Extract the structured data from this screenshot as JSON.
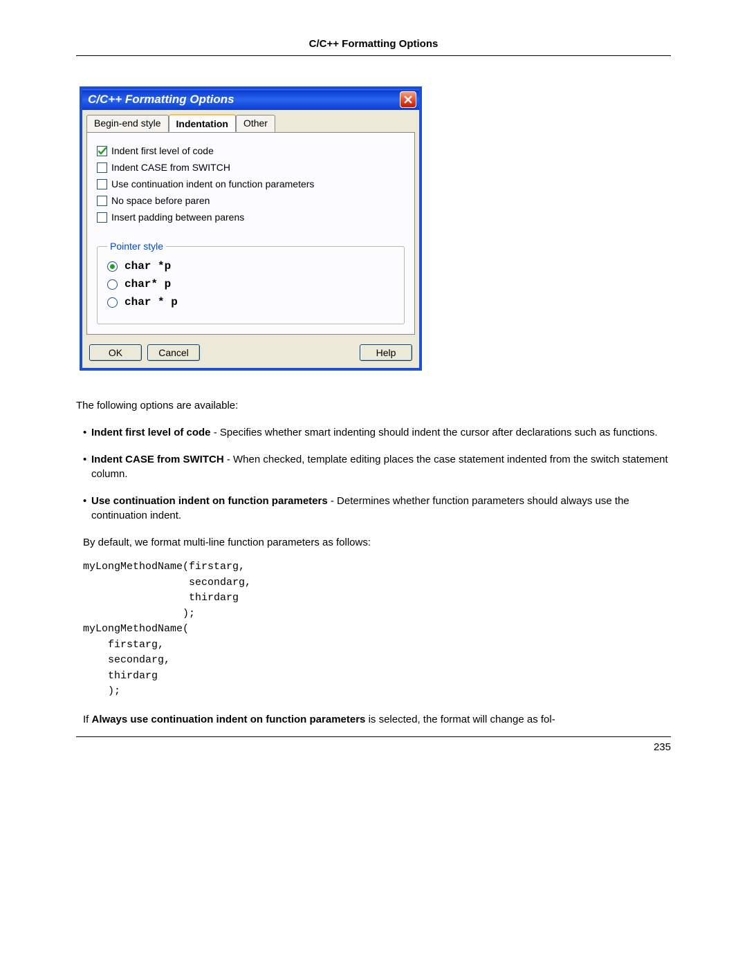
{
  "header": {
    "title": "C/C++ Formatting Options"
  },
  "dialog": {
    "title": "C/C++ Formatting Options",
    "tabs": [
      {
        "label": "Begin-end style",
        "active": false
      },
      {
        "label": "Indentation",
        "active": true
      },
      {
        "label": "Other",
        "active": false
      }
    ],
    "checkboxes": [
      {
        "label": "Indent first level of code",
        "checked": true
      },
      {
        "label": "Indent CASE from SWITCH",
        "checked": false
      },
      {
        "label": "Use continuation indent on function parameters",
        "checked": false
      },
      {
        "label": "No space before paren",
        "checked": false
      },
      {
        "label": "Insert padding between parens",
        "checked": false
      }
    ],
    "pointer_legend": "Pointer style",
    "radios": [
      {
        "label": "char *p",
        "selected": true
      },
      {
        "label": "char* p",
        "selected": false
      },
      {
        "label": "char * p",
        "selected": false
      }
    ],
    "buttons": {
      "ok": "OK",
      "cancel": "Cancel",
      "help": "Help"
    }
  },
  "body": {
    "intro": "The following options are available:",
    "items": [
      {
        "title": "Indent first level of code",
        "desc": " - Specifies whether smart indenting should indent the cursor after declarations such as functions."
      },
      {
        "title": "Indent CASE from SWITCH",
        "desc": " - When checked, template editing places the case statement indented from the switch statement column."
      },
      {
        "title": "Use continuation indent on function parameters",
        "desc": " - Determines whether function parameters should always use the continuation indent."
      }
    ],
    "default_line": "By default, we format multi-line function parameters as follows:",
    "code": "myLongMethodName(firstarg,\n                 secondarg,\n                 thirdarg\n                );\nmyLongMethodName(\n    firstarg,\n    secondarg,\n    thirdarg\n    );",
    "trailing_prefix": "If ",
    "trailing_bold": "Always use continuation indent on function parameters",
    "trailing_suffix": " is selected, the format will change as fol-"
  },
  "page_number": "235"
}
